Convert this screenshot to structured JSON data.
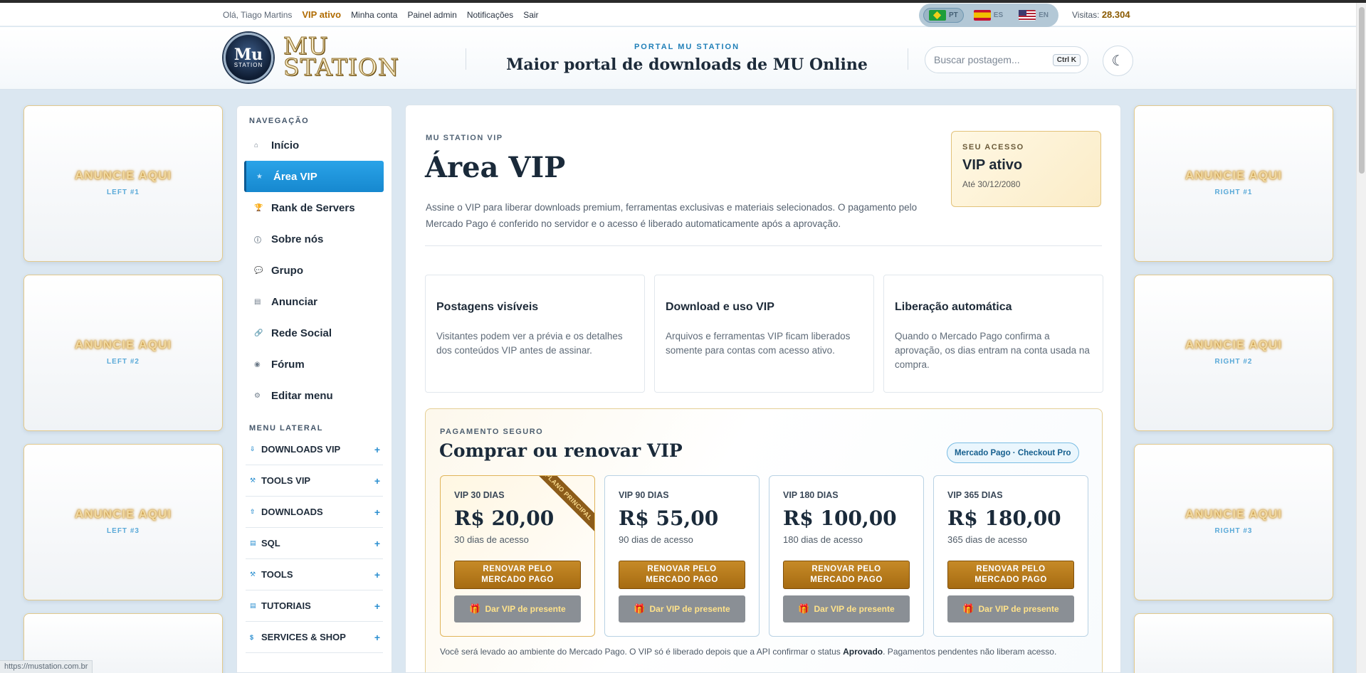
{
  "userbar": {
    "greeting": "Olá, Tiago Martins",
    "vip": "VIP ativo",
    "my_account": "Minha conta",
    "admin": "Painel admin",
    "notifications": "Notificações",
    "logout": "Sair",
    "visits_label": "Visitas:",
    "visits_value": "28.304"
  },
  "languages": [
    {
      "code": "PT",
      "flag": "br-flag"
    },
    {
      "code": "ES",
      "flag": "es-flag"
    },
    {
      "code": "EN",
      "flag": "us-flag"
    }
  ],
  "header": {
    "logo_emblem_top": "Mu",
    "logo_emblem_bottom": "STATION",
    "logo_line1": "MU",
    "logo_line2": "STATION",
    "kicker": "PORTAL MU STATION",
    "title": "Maior portal de downloads de MU Online",
    "search_placeholder": "Buscar postagem...",
    "search_shortcut": "Ctrl K",
    "theme_icon": "☾"
  },
  "ads_left": [
    {
      "title": "ANUNCIE AQUI",
      "label": "LEFT #1"
    },
    {
      "title": "ANUNCIE AQUI",
      "label": "LEFT #2"
    },
    {
      "title": "ANUNCIE AQUI",
      "label": "LEFT #3"
    }
  ],
  "ads_right": [
    {
      "title": "ANUNCIE AQUI",
      "label": "RIGHT #1"
    },
    {
      "title": "ANUNCIE AQUI",
      "label": "RIGHT #2"
    },
    {
      "title": "ANUNCIE AQUI",
      "label": "RIGHT #3"
    }
  ],
  "sidebar": {
    "nav_heading": "NAVEGAÇÃO",
    "nav": [
      {
        "label": "Início",
        "icon": "⌂"
      },
      {
        "label": "Área VIP",
        "icon": "★"
      },
      {
        "label": "Rank de Servers",
        "icon": "🏆"
      },
      {
        "label": "Sobre nós",
        "icon": "ⓘ"
      },
      {
        "label": "Grupo",
        "icon": "💬"
      },
      {
        "label": "Anunciar",
        "icon": "▤"
      },
      {
        "label": "Rede Social",
        "icon": "🔗"
      },
      {
        "label": "Fórum",
        "icon": "◉"
      },
      {
        "label": "Editar menu",
        "icon": "⚙"
      }
    ],
    "menu_heading": "MENU LATERAL",
    "menu": [
      {
        "label": "DOWNLOADS VIP",
        "icon": "⇩"
      },
      {
        "label": "TOOLS VIP",
        "icon": "⚒"
      },
      {
        "label": "DOWNLOADS",
        "icon": "⇧"
      },
      {
        "label": "SQL",
        "icon": "▤"
      },
      {
        "label": "TOOLS",
        "icon": "⚒"
      },
      {
        "label": "TUTORIAIS",
        "icon": "▤"
      },
      {
        "label": "SERVICES & SHOP",
        "icon": "$"
      }
    ],
    "plus": "+"
  },
  "main": {
    "kicker": "MU STATION VIP",
    "title": "Área VIP",
    "intro": "Assine o VIP para liberar downloads premium, ferramentas exclusivas e materiais selecionados. O pagamento pelo Mercado Pago é conferido no servidor e o acesso é liberado automaticamente após a aprovação.",
    "access": {
      "kicker": "SEU ACESSO",
      "value": "VIP ativo",
      "date": "Até 30/12/2080"
    },
    "features": [
      {
        "title": "Postagens visíveis",
        "desc": "Visitantes podem ver a prévia e os detalhes dos conteúdos VIP antes de assinar."
      },
      {
        "title": "Download e uso VIP",
        "desc": "Arquivos e ferramentas VIP ficam liberados somente para contas com acesso ativo."
      },
      {
        "title": "Liberação automática",
        "desc": "Quando o Mercado Pago confirma a aprovação, os dias entram na conta usada na compra."
      }
    ],
    "payment": {
      "kicker": "PAGAMENTO SEGURO",
      "title": "Comprar ou renovar VIP",
      "badge": "Mercado Pago · Checkout Pro",
      "ribbon": "PLANO PRINCIPAL",
      "renew_line1": "RENOVAR PELO",
      "renew_line2": "MERCADO PAGO",
      "gift_label": "Dar VIP de presente",
      "plans": [
        {
          "name": "VIP 30 DIAS",
          "price": "R$ 20,00",
          "days": "30 dias de acesso"
        },
        {
          "name": "VIP 90 DIAS",
          "price": "R$ 55,00",
          "days": "90 dias de acesso"
        },
        {
          "name": "VIP 180 DIAS",
          "price": "R$ 100,00",
          "days": "180 dias de acesso"
        },
        {
          "name": "VIP 365 DIAS",
          "price": "R$ 180,00",
          "days": "365 dias de acesso"
        }
      ],
      "note_before": "Você será levado ao ambiente do Mercado Pago. O VIP só é liberado depois que a API confirmar o status ",
      "note_bold": "Aprovado",
      "note_after": ". Pagamentos pendentes não liberam acesso."
    }
  },
  "statusbar": "https://mustation.com.br"
}
